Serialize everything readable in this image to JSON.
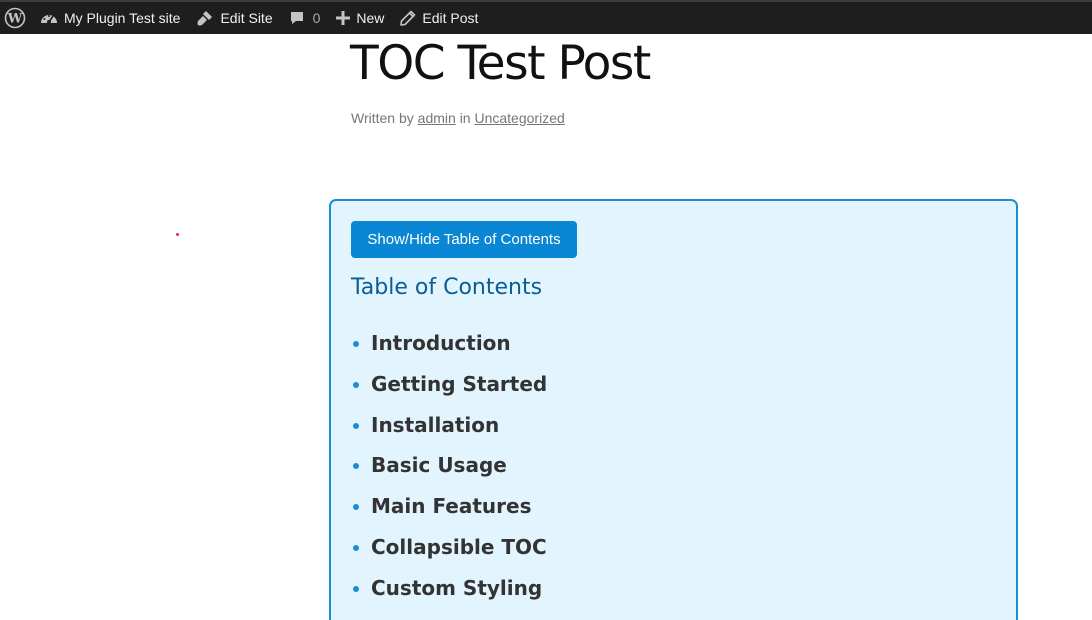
{
  "admin_bar": {
    "site_name": "My Plugin Test site",
    "edit_site": "Edit Site",
    "comments_count": "0",
    "new": "New",
    "edit_post": "Edit Post"
  },
  "post": {
    "title": "TOC Test Post",
    "meta": {
      "written_by": "Written by",
      "author": "admin",
      "in": "in",
      "category": "Uncategorized"
    }
  },
  "toc": {
    "toggle_label": "Show/Hide Table of Contents",
    "heading": "Table of Contents",
    "items": [
      "Introduction",
      "Getting Started",
      "Installation",
      "Basic Usage",
      "Main Features",
      "Collapsible TOC",
      "Custom Styling"
    ]
  },
  "colors": {
    "admin_bar_bg": "#1e1e1e",
    "toc_bg": "#e2f4fd",
    "toc_border": "#1e8cd3",
    "button_bg": "#0a87d4",
    "toc_heading": "#0b5e94"
  },
  "icons": {
    "wordpress": "wordpress-logo-icon",
    "site": "dashboard-icon",
    "edit_site": "brush-icon",
    "comments": "comment-bubble-icon",
    "new": "plus-icon",
    "edit_post": "pencil-icon"
  }
}
